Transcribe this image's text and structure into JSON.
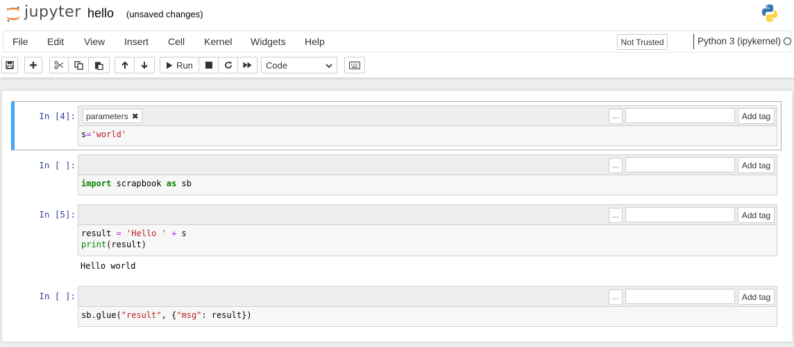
{
  "header": {
    "logo_text": "jupyter",
    "notebook_name": "hello",
    "save_status": "(unsaved changes)",
    "logo_icon": "jupyter-logo-icon",
    "kernel_logo_icon": "python-logo-icon"
  },
  "menu": {
    "items": [
      "File",
      "Edit",
      "View",
      "Insert",
      "Cell",
      "Kernel",
      "Widgets",
      "Help"
    ],
    "trusted_label": "Not Trusted",
    "kernel_name": "Python 3 (ipykernel)"
  },
  "toolbar": {
    "run_label": "Run",
    "cell_type": "Code",
    "cell_type_options": [
      "Code"
    ]
  },
  "cells": [
    {
      "prompt": "In [4]:",
      "tags": [
        "parameters"
      ],
      "source": "s='world'",
      "add_tag_label": "Add tag",
      "more_label": "..."
    },
    {
      "prompt": "In [ ]:",
      "tags": [],
      "source": "import scrapbook as sb",
      "add_tag_label": "Add tag",
      "more_label": "..."
    },
    {
      "prompt": "In [5]:",
      "tags": [],
      "source": "result = 'Hello ' + s\nprint(result)",
      "output": "Hello world",
      "add_tag_label": "Add tag",
      "more_label": "..."
    },
    {
      "prompt": "In [ ]:",
      "tags": [],
      "source": "sb.glue(\"result\", {\"msg\": result})",
      "add_tag_label": "Add tag",
      "more_label": "..."
    }
  ],
  "colors": {
    "selected_cell_border": "#42a5f5",
    "prompt": "#303f9f",
    "keyword": "#008000",
    "string": "#ba2121",
    "operator": "#aa22ff"
  }
}
